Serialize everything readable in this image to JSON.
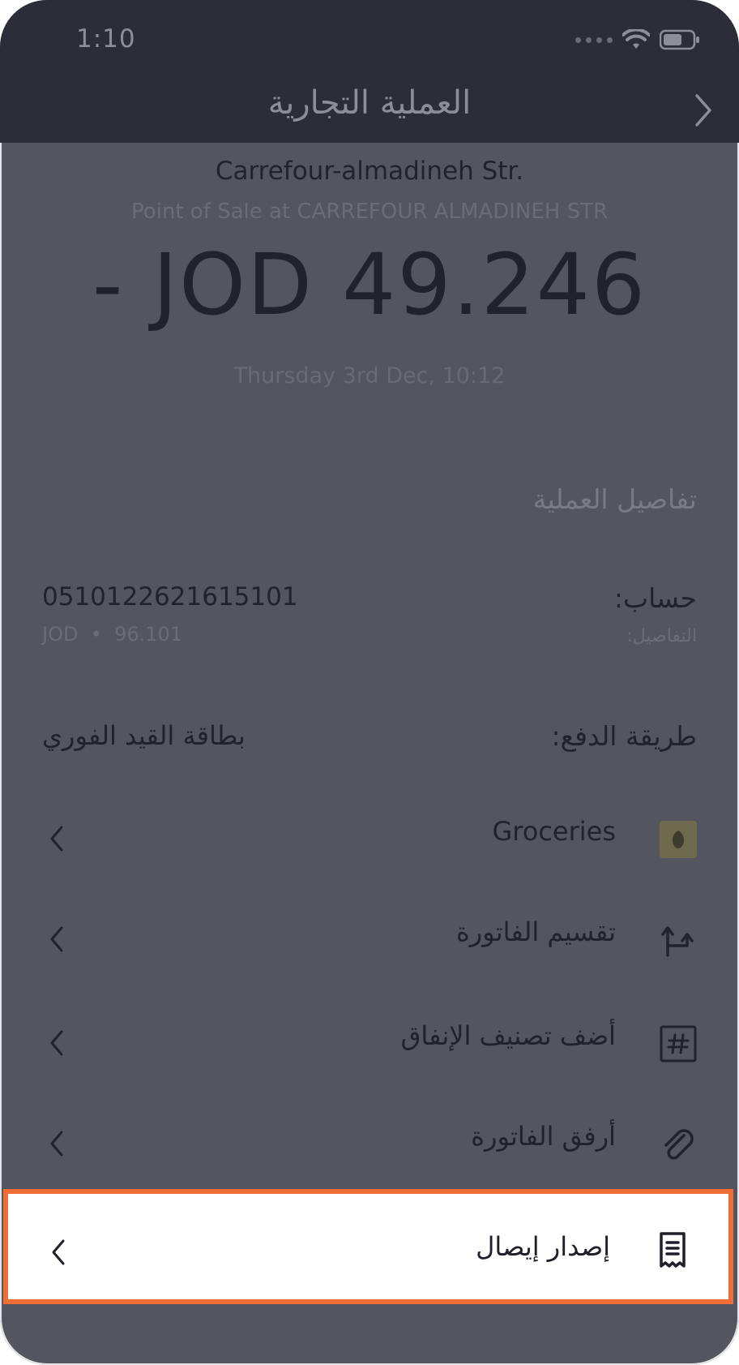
{
  "status_bar": {
    "time": "1:10"
  },
  "header": {
    "title": "العملية التجارية"
  },
  "transaction": {
    "merchant": "Carrefour-almadineh Str.",
    "merchant_subtitle": "Point of Sale at CARREFOUR ALMADINEH STR",
    "amount": "- JOD 49.246",
    "date": "Thursday 3rd Dec, 10:12"
  },
  "details": {
    "section_title": "تفاصيل العملية",
    "account_label": "حساب:",
    "account_number": "0510122621615101",
    "details_label": "التفاصيل:",
    "details_value": "JOD  •  96.101",
    "payment_label": "طريقة الدفع:",
    "payment_value": "بطاقة القيد الفوري"
  },
  "actions": [
    {
      "label": "Groceries",
      "icon": "groceries-icon"
    },
    {
      "label": "تقسيم الفاتورة",
      "icon": "split-bill-icon"
    },
    {
      "label": "أضف تصنيف الإنفاق",
      "icon": "hashtag-icon"
    },
    {
      "label": "أرفق الفاتورة",
      "icon": "paperclip-icon"
    },
    {
      "label": "إصدار إيصال",
      "icon": "receipt-icon"
    }
  ],
  "colors": {
    "highlight_border": "#f06e36",
    "header_bg": "#2d2d3a",
    "overlay_bg": "#55555f"
  }
}
